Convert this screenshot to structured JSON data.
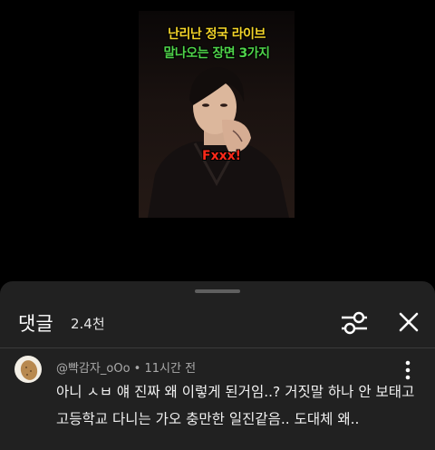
{
  "video": {
    "title_line1": "난리난 정국 라이브",
    "title_line2": "말나오는 장면 3가지",
    "caption": "Fxxx!"
  },
  "comments_panel": {
    "title": "댓글",
    "count": "2.4천",
    "filter_icon": "sliders-icon",
    "close_icon": "close-icon"
  },
  "comment": {
    "author": "@빡감자_oOo",
    "separator": "•",
    "time": "11시간 전",
    "text": "아니 ㅅㅂ 얘 진짜 왜 이렇게 된거임..? 거짓말 하나 안 보태고 고등학교 다니는 가오 충만한 일진같음.. 도대체 왜..",
    "menu_icon": "more-vertical-icon",
    "avatar_icon": "potato-avatar"
  },
  "colors": {
    "sheet_bg": "#212121",
    "title_yellow": "#f2d329",
    "title_green": "#4fd34a",
    "caption_red": "#ff2a1a"
  }
}
